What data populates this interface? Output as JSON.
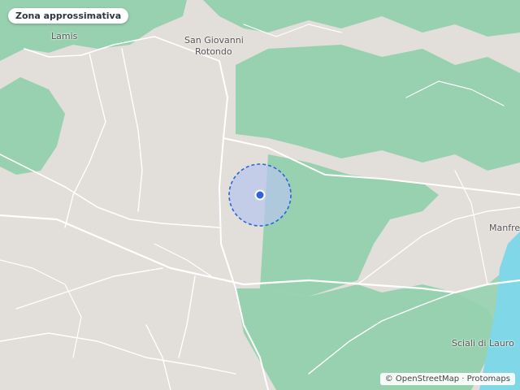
{
  "badge": {
    "label": "Zona approssimativa"
  },
  "places": {
    "lamis": "Lamis",
    "san_giovanni": "San Giovanni",
    "rotondo": "Rotondo",
    "manfredonia": "Manfre",
    "sciali": "Sciali di Lauro"
  },
  "attribution": {
    "osm": "© OpenStreetMap",
    "sep": " · ",
    "protomaps": "Protomaps"
  },
  "colors": {
    "land": "#e2ded9",
    "forest": "#97d1b0",
    "water": "#7fd7e8",
    "road": "#ffffff",
    "accuracy_fill": "#b8c6ee",
    "accuracy_stroke": "#2f63d8",
    "marker": "#2f63d8"
  },
  "icons": {
    "location": "location-dot-icon"
  }
}
